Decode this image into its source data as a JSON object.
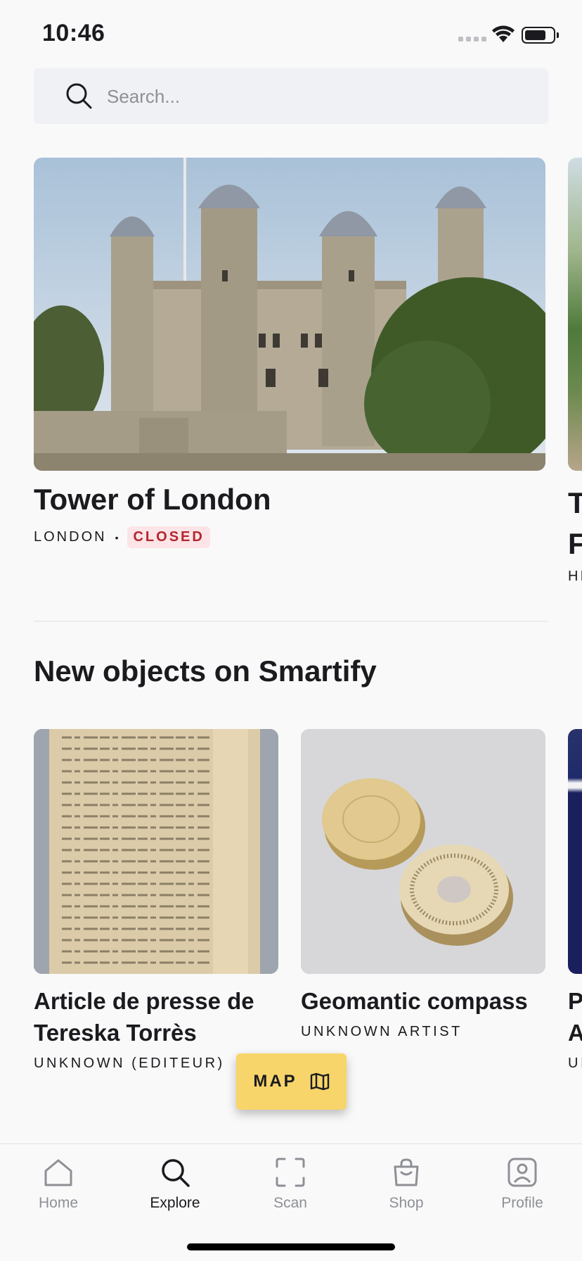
{
  "status_bar": {
    "time": "10:46"
  },
  "search": {
    "placeholder": "Search..."
  },
  "hero": {
    "title": "Tower of London",
    "location": "LONDON",
    "status": "CLOSED",
    "peek_title": "T F",
    "peek_sub": "HI"
  },
  "section": {
    "title": "New objects on Smartify"
  },
  "objects": [
    {
      "title": "Article de presse de Tereska Torrès",
      "artist": "UNKNOWN (EDITEUR)"
    },
    {
      "title": "Geomantic compass",
      "artist": "UNKNOWN ARTIST"
    },
    {
      "title": "P A",
      "artist": "UI"
    }
  ],
  "map_button": {
    "label": "MAP"
  },
  "tabbar": {
    "items": [
      {
        "label": "Home",
        "icon": "home-icon"
      },
      {
        "label": "Explore",
        "icon": "search-icon",
        "active": true
      },
      {
        "label": "Scan",
        "icon": "scan-icon"
      },
      {
        "label": "Shop",
        "icon": "shopping-bag-icon"
      },
      {
        "label": "Profile",
        "icon": "profile-icon"
      }
    ]
  },
  "colors": {
    "accent": "#f7d56a",
    "closed_bg": "#fde4e6",
    "closed_text": "#b3262f",
    "search_bg": "#eff1f4"
  }
}
